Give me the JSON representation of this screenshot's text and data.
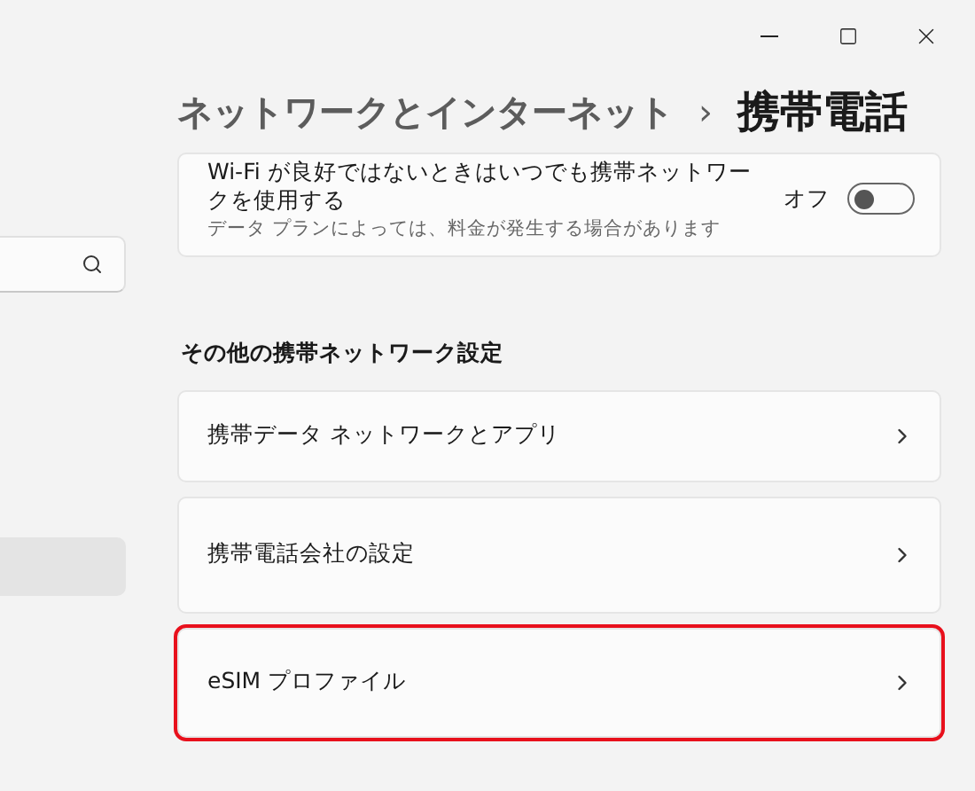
{
  "breadcrumb": {
    "parent": "ネットワークとインターネット",
    "separator": "›",
    "current": "携帯電話"
  },
  "sidebar": {
    "items": [
      {
        "selected": true
      }
    ]
  },
  "wifi_card": {
    "title": "Wi-Fi が良好ではないときはいつでも携帯ネットワークを使用する",
    "description": "データ プランによっては、料金が発生する場合があります",
    "state_label": "オフ",
    "on": false
  },
  "section_title": "その他の携帯ネットワーク設定",
  "links": [
    {
      "label": "携帯データ ネットワークとアプリ",
      "highlighted": false
    },
    {
      "label": "携帯電話会社の設定",
      "highlighted": false
    },
    {
      "label": "eSIM プロファイル",
      "highlighted": true
    }
  ]
}
